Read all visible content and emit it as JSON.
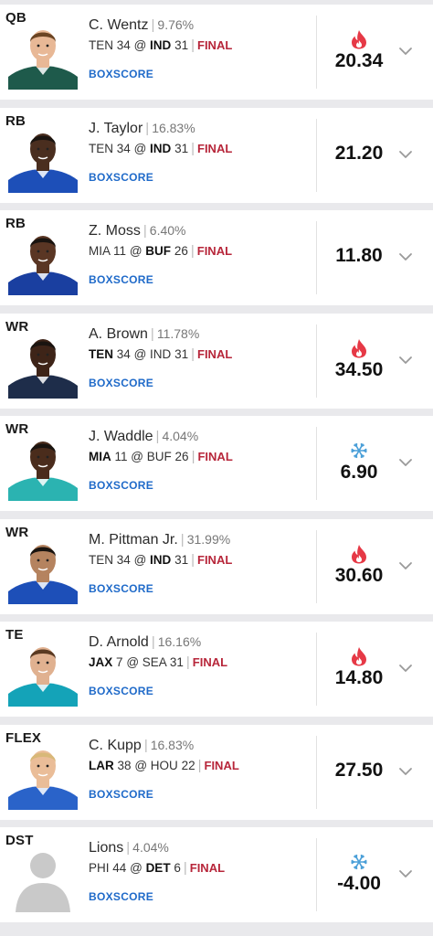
{
  "boxscore_label": "BOXSCORE",
  "final_label": "FINAL",
  "colors": {
    "final": "#b7263a",
    "link": "#1f6ac9",
    "hot": "#e63946",
    "cold": "#4a9fd8"
  },
  "players": [
    {
      "pos": "QB",
      "name": "C. Wentz",
      "pct": "9.76%",
      "away": "TEN",
      "away_score": "34",
      "sep": "@",
      "home": "IND",
      "home_score": "31",
      "bold": "home",
      "score": "20.34",
      "trend": "hot",
      "jersey": "#1e5a4b",
      "skin": "#e8b896",
      "hair": "#6b4423"
    },
    {
      "pos": "RB",
      "name": "J. Taylor",
      "pct": "16.83%",
      "away": "TEN",
      "away_score": "34",
      "sep": "@",
      "home": "IND",
      "home_score": "31",
      "bold": "home",
      "score": "21.20",
      "trend": "none",
      "jersey": "#1d4fb8",
      "skin": "#4a2e1f",
      "hair": "#1a1410"
    },
    {
      "pos": "RB",
      "name": "Z. Moss",
      "pct": "6.40%",
      "away": "MIA",
      "away_score": "11",
      "sep": "@",
      "home": "BUF",
      "home_score": "26",
      "bold": "home",
      "score": "11.80",
      "trend": "none",
      "jersey": "#1a3fa0",
      "skin": "#5a3624",
      "hair": "#1a1410"
    },
    {
      "pos": "WR",
      "name": "A. Brown",
      "pct": "11.78%",
      "away": "TEN",
      "away_score": "34",
      "sep": "@",
      "home": "IND",
      "home_score": "31",
      "bold": "away",
      "score": "34.50",
      "trend": "hot",
      "jersey": "#1e2d4a",
      "skin": "#3e2418",
      "hair": "#1a1410"
    },
    {
      "pos": "WR",
      "name": "J. Waddle",
      "pct": "4.04%",
      "away": "MIA",
      "away_score": "11",
      "sep": "@",
      "home": "BUF",
      "home_score": "26",
      "bold": "away",
      "score": "6.90",
      "trend": "cold",
      "jersey": "#2bb3b1",
      "skin": "#4a2c1c",
      "hair": "#1a1410"
    },
    {
      "pos": "WR",
      "name": "M. Pittman Jr.",
      "pct": "31.99%",
      "away": "TEN",
      "away_score": "34",
      "sep": "@",
      "home": "IND",
      "home_score": "31",
      "bold": "home",
      "score": "30.60",
      "trend": "hot",
      "jersey": "#1d4fb8",
      "skin": "#b5835f",
      "hair": "#1a1410"
    },
    {
      "pos": "TE",
      "name": "D. Arnold",
      "pct": "16.16%",
      "away": "JAX",
      "away_score": "7",
      "sep": "@",
      "home": "SEA",
      "home_score": "31",
      "bold": "away",
      "score": "14.80",
      "trend": "hot",
      "jersey": "#14a3b8",
      "skin": "#e0b190",
      "hair": "#5a3a22"
    },
    {
      "pos": "FLEX",
      "name": "C. Kupp",
      "pct": "16.83%",
      "away": "LAR",
      "away_score": "38",
      "sep": "@",
      "home": "HOU",
      "home_score": "22",
      "bold": "away",
      "score": "27.50",
      "trend": "none",
      "jersey": "#2a63c9",
      "skin": "#eabd98",
      "hair": "#d8b878"
    },
    {
      "pos": "DST",
      "name": "Lions",
      "pct": "4.04%",
      "away": "PHI",
      "away_score": "44",
      "sep": "@",
      "home": "DET",
      "home_score": "6",
      "bold": "home",
      "score": "-4.00",
      "trend": "cold",
      "jersey": "",
      "skin": "",
      "hair": "",
      "silhouette": true
    }
  ]
}
